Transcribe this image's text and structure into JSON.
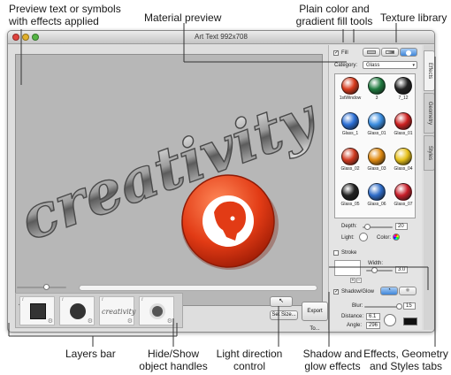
{
  "callouts": {
    "preview": "Preview text or symbols\nwith effects applied",
    "material_preview": "Material preview",
    "fill_tools": "Plain color and\ngradient fill tools",
    "texture_library": "Texture library",
    "layers_bar": "Layers bar",
    "hide_show": "Hide/Show\nobject handles",
    "light_direction": "Light direction\ncontrol",
    "shadow_glow": "Shadow and\nglow effects",
    "effects_tabs": "Effects, Geometry\nand Styles tabs"
  },
  "window": {
    "title": "Art Text 992x708",
    "canvas_text": "creativity",
    "set_size_label": "Set Size...",
    "export_label": "Export To..."
  },
  "layers": {
    "items": [
      {
        "name": "square"
      },
      {
        "name": "circle"
      },
      {
        "name": "creativity-text",
        "label": "creativity"
      },
      {
        "name": "lion-symbol"
      }
    ],
    "info_glyph": "i",
    "gear_glyph": "⚙"
  },
  "panel": {
    "fill_label": "Fill",
    "category_label": "Category:",
    "category_value": "Glass",
    "materials": [
      {
        "label": "1stWindow",
        "color": "#d83a1c"
      },
      {
        "label": "3",
        "color": "#1f7a3f"
      },
      {
        "label": "7_12",
        "color": "#222222"
      },
      {
        "label": "Glass_1",
        "color": "#2b6fd6"
      },
      {
        "label": "Glass_01",
        "color": "#3a8de0"
      },
      {
        "label": "Glass_01",
        "color": "#cc2020"
      },
      {
        "label": "Glass_02",
        "color": "#d03a20"
      },
      {
        "label": "Glass_03",
        "color": "#e08a10"
      },
      {
        "label": "Glass_04",
        "color": "#e6c01a"
      },
      {
        "label": "Glass_05",
        "color": "#222222"
      },
      {
        "label": "Glass_06",
        "color": "#2e6cc8"
      },
      {
        "label": "Glass_07",
        "color": "#c81e2a"
      }
    ],
    "depth_label": "Depth:",
    "depth_value": "20",
    "light_label": "Light:",
    "color_label": "Color:",
    "stroke_label": "Stroke",
    "width_label": "Width:",
    "width_value": "3.0",
    "shadow_label": "Shadow/Glow",
    "blur_label": "Blur:",
    "blur_value": "15",
    "distance_label": "Distance:",
    "distance_value": "6.1",
    "angle_label": "Angle:",
    "angle_value": "296"
  },
  "tabs": [
    "Effects",
    "Geometry",
    "Styles"
  ]
}
